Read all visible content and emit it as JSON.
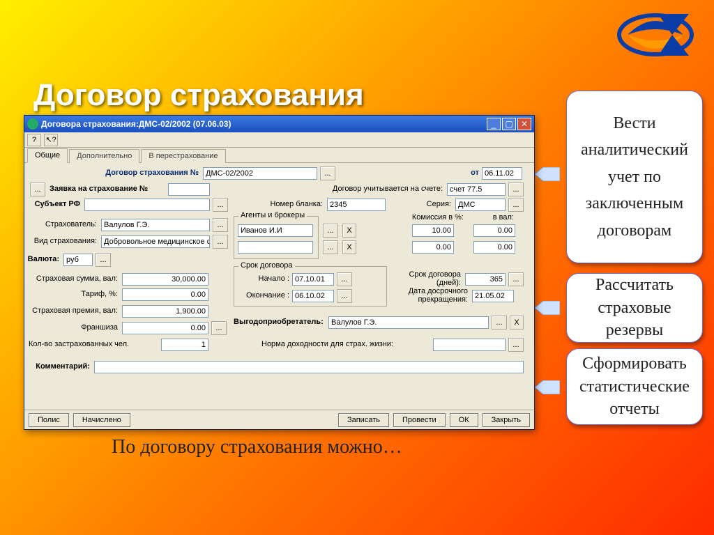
{
  "slide": {
    "title": "Договор страхования",
    "caption": "По договору страхования можно…"
  },
  "callouts": {
    "c1": "Вести аналитический учет по заключенным договорам",
    "c2": "Рассчитать страховые резервы",
    "c3": "Сформировать статистические отчеты"
  },
  "win": {
    "title": "Договора страхования:ДМС-02/2002 (07.06.03)",
    "toolbar": {
      "help": "?",
      "cursor": "↖?"
    },
    "tabs": [
      {
        "label": "Общие",
        "active": true
      },
      {
        "label": "Дополнительно",
        "active": false
      },
      {
        "label": "В перестрахование",
        "active": false
      }
    ],
    "labels": {
      "contract_no": "Договор страхования №",
      "ot": "от",
      "request_no": "Заявка на страхование №",
      "accounted": "Договор учитывается на счете:",
      "subject_rf": "Субъект РФ",
      "blank_no": "Номер бланка:",
      "series": "Серия:",
      "insurer": "Страхователь:",
      "ins_type": "Вид страхования:",
      "currency": "Валюта:",
      "ins_sum": "Страховая сумма, вал:",
      "tariff": "Тариф, %:",
      "premium": "Страховая премия, вал:",
      "franchise": "Франшиза",
      "persons": "Кол-во застрахованных чел.",
      "comment": "Комментарий:",
      "agents": "Агенты и брокеры",
      "commission_pct": "Комиссия в %:",
      "commission_val": "в вал:",
      "term": "Срок договора",
      "start": "Начало :",
      "end": "Окончание :",
      "term_days": "Срок договора (дней):",
      "early_end": "Дата досрочного прекращения:",
      "beneficiary": "Выгодоприобретатель:",
      "profit_norm": "Норма доходности для страх. жизни:",
      "x": "X",
      "dots": "..."
    },
    "values": {
      "contract_no": "ДМС-02/2002",
      "date": "06.11.02",
      "request_no": "",
      "account": "счет 77.5",
      "subject_rf": "",
      "blank_no": "2345",
      "series": "ДМС",
      "insurer": "Валулов Г.Э.",
      "ins_type": "Добровольное медицинское ст",
      "currency": "руб",
      "ins_sum": "30,000.00",
      "tariff": "0.00",
      "premium": "1,900.00",
      "franchise": "0.00",
      "persons": "1",
      "comment": "",
      "agent1": "Иванов И.И",
      "agent2": "",
      "comm_pct1": "10.00",
      "comm_val1": "0.00",
      "comm_pct2": "0.00",
      "comm_val2": "0.00",
      "start": "07.10.01",
      "end": "06.10.02",
      "term_days": "365",
      "early_end": "21.05.02",
      "beneficiary": "Валулов Г.Э.",
      "profit_norm": ""
    },
    "buttons": {
      "polis": "Полис",
      "accrued": "Начислено",
      "write": "Записать",
      "post": "Провести",
      "ok": "ОК",
      "close": "Закрыть"
    }
  }
}
